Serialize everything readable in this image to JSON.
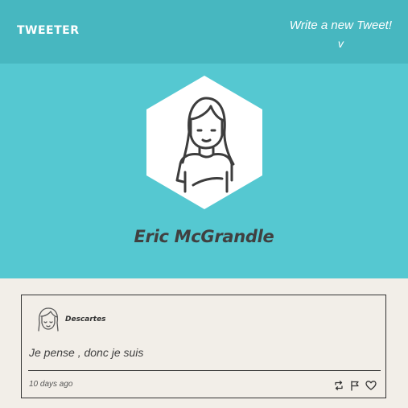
{
  "nav": {
    "brand": "TWEETER",
    "write_label": "Write a new Tweet!",
    "write_caret": "v"
  },
  "profile": {
    "name": "Eric McGrandle",
    "avatar_icon": "woman-avatar-icon"
  },
  "tweets": [
    {
      "author": "Descartes",
      "avatar_icon": "woman-avatar-icon",
      "text": "Je pense , donc je suis",
      "time": "10 days ago",
      "actions": [
        "retweet-icon",
        "flag-icon",
        "heart-icon"
      ]
    }
  ],
  "colors": {
    "nav_bg": "#47b7c0",
    "hero_bg": "#55c8d1",
    "page_bg": "#f2eee8",
    "text_dark": "#404040"
  }
}
